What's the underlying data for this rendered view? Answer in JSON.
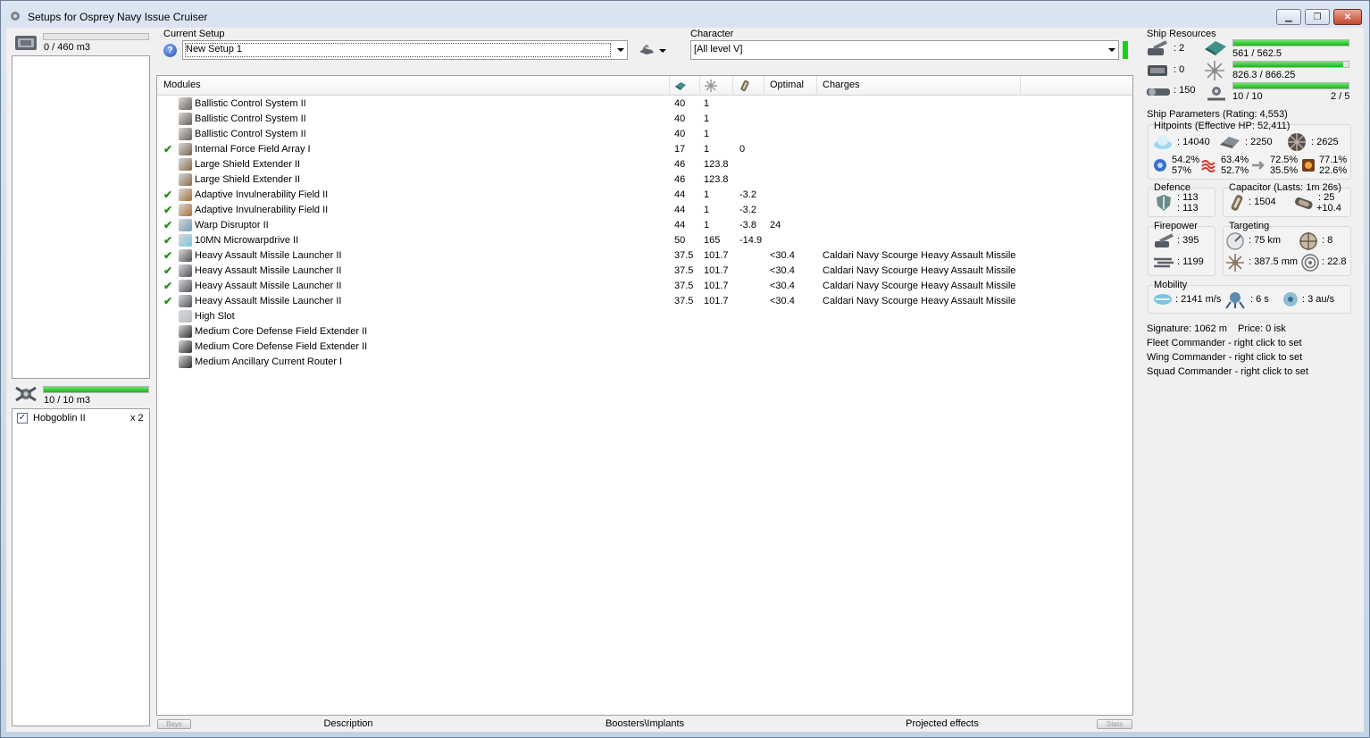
{
  "window": {
    "title": "Setups for Osprey Navy Issue Cruiser",
    "minimize_icon": "minimize-icon",
    "maximize_icon": "maximize-icon",
    "close_icon": "close-icon"
  },
  "left": {
    "cargo_capacity": "0 / 460 m3",
    "cargo_fill": 0.0,
    "drone_capacity": "10 / 10 m3",
    "drone_fill": 1.0,
    "drones": [
      {
        "name": "Hobgoblin II",
        "count": "x 2",
        "checked": true
      }
    ]
  },
  "setup": {
    "current_setup_label": "Current Setup",
    "current_setup_value": "New Setup 1",
    "character_label": "Character",
    "character_value": "[All level V]"
  },
  "modules": {
    "headers": [
      "Modules",
      "Optimal",
      "Charges"
    ],
    "rows": [
      {
        "check": "",
        "name": "Ballistic Control System II",
        "cpu": "40",
        "pg": "1",
        "cap": "",
        "optimal": "",
        "charges": "",
        "icon": "ballistic-control-icon"
      },
      {
        "check": "",
        "name": "Ballistic Control System II",
        "cpu": "40",
        "pg": "1",
        "cap": "",
        "optimal": "",
        "charges": "",
        "icon": "ballistic-control-icon"
      },
      {
        "check": "",
        "name": "Ballistic Control System II",
        "cpu": "40",
        "pg": "1",
        "cap": "",
        "optimal": "",
        "charges": "",
        "icon": "ballistic-control-icon"
      },
      {
        "check": "✔",
        "name": "Internal Force Field Array I",
        "cpu": "17",
        "pg": "1",
        "cap": "0",
        "optimal": "",
        "charges": "",
        "icon": "force-field-icon"
      },
      {
        "check": "",
        "name": "Large Shield Extender II",
        "cpu": "46",
        "pg": "123.8",
        "cap": "",
        "optimal": "",
        "charges": "",
        "icon": "shield-extender-icon"
      },
      {
        "check": "",
        "name": "Large Shield Extender II",
        "cpu": "46",
        "pg": "123.8",
        "cap": "",
        "optimal": "",
        "charges": "",
        "icon": "shield-extender-icon"
      },
      {
        "check": "✔",
        "name": "Adaptive Invulnerability Field II",
        "cpu": "44",
        "pg": "1",
        "cap": "-3.2",
        "optimal": "",
        "charges": "",
        "icon": "invulnerability-field-icon"
      },
      {
        "check": "✔",
        "name": "Adaptive Invulnerability Field II",
        "cpu": "44",
        "pg": "1",
        "cap": "-3.2",
        "optimal": "",
        "charges": "",
        "icon": "invulnerability-field-icon"
      },
      {
        "check": "✔",
        "name": "Warp Disruptor II",
        "cpu": "44",
        "pg": "1",
        "cap": "-3.8",
        "optimal": "24",
        "charges": "",
        "icon": "warp-disruptor-icon"
      },
      {
        "check": "✔",
        "name": "10MN Microwarpdrive II",
        "cpu": "50",
        "pg": "165",
        "cap": "-14.9",
        "optimal": "",
        "charges": "",
        "icon": "microwarpdrive-icon"
      },
      {
        "check": "✔",
        "name": "Heavy Assault Missile Launcher II",
        "cpu": "37.5",
        "pg": "101.7",
        "cap": "",
        "optimal": "<30.4",
        "charges": "Caldari Navy Scourge Heavy Assault Missile",
        "icon": "missile-launcher-icon"
      },
      {
        "check": "✔",
        "name": "Heavy Assault Missile Launcher II",
        "cpu": "37.5",
        "pg": "101.7",
        "cap": "",
        "optimal": "<30.4",
        "charges": "Caldari Navy Scourge Heavy Assault Missile",
        "icon": "missile-launcher-icon"
      },
      {
        "check": "✔",
        "name": "Heavy Assault Missile Launcher II",
        "cpu": "37.5",
        "pg": "101.7",
        "cap": "",
        "optimal": "<30.4",
        "charges": "Caldari Navy Scourge Heavy Assault Missile",
        "icon": "missile-launcher-icon"
      },
      {
        "check": "✔",
        "name": "Heavy Assault Missile Launcher II",
        "cpu": "37.5",
        "pg": "101.7",
        "cap": "",
        "optimal": "<30.4",
        "charges": "Caldari Navy Scourge Heavy Assault Missile",
        "icon": "missile-launcher-icon"
      },
      {
        "check": "",
        "name": "High Slot",
        "cpu": "",
        "pg": "",
        "cap": "",
        "optimal": "",
        "charges": "",
        "icon": "high-slot-icon"
      },
      {
        "check": "",
        "name": "Medium Core Defense Field Extender II",
        "cpu": "",
        "pg": "",
        "cap": "",
        "optimal": "",
        "charges": "",
        "icon": "rig-icon"
      },
      {
        "check": "",
        "name": "Medium Core Defense Field Extender II",
        "cpu": "",
        "pg": "",
        "cap": "",
        "optimal": "",
        "charges": "",
        "icon": "rig-icon"
      },
      {
        "check": "",
        "name": "Medium Ancillary Current Router I",
        "cpu": "",
        "pg": "",
        "cap": "",
        "optimal": "",
        "charges": "",
        "icon": "rig-icon"
      }
    ]
  },
  "resources": {
    "title": "Ship Resources",
    "turret_hardpoints": ": 2",
    "launcher_hardpoints": ": 0",
    "calibration": ": 150",
    "cpu": "561 / 562.5",
    "cpu_fill": 0.997,
    "powergrid": "826.3 / 866.25",
    "powergrid_fill": 0.954,
    "drone_bandwidth": "10 / 10",
    "drone_bandwidth_fill": 1.0,
    "drones_active": "2 / 5"
  },
  "params": {
    "title": "Ship Parameters (Rating: 4,553)",
    "hitpoints_title": "Hitpoints (Effective HP: 52,411)",
    "shield_hp": ": 14040",
    "armor_hp": ": 2250",
    "structure_hp": ": 2625",
    "res_em_shield": "54.2%",
    "res_em_armor": "57%",
    "res_th_shield": "63.4%",
    "res_th_armor": "52.7%",
    "res_kin_shield": "72.5%",
    "res_kin_armor": "35.5%",
    "res_exp_shield": "77.1%",
    "res_exp_armor": "22.6%",
    "defence_title": "Defence",
    "defence_1": ": 113",
    "defence_2": ": 113",
    "capacitor_title": "Capacitor (Lasts: 1m 26s)",
    "capacitor_amount": ": 1504",
    "capacitor_1": ": 25",
    "capacitor_2": "+10.4",
    "firepower_title": "Firepower",
    "firepower_1": ": 395",
    "firepower_2": ": 1199",
    "targeting_title": "Targeting",
    "targeting_range": ": 75 km",
    "targeting_max": ": 8",
    "scan_res": ": 387.5 mm",
    "sensor_strength": ": 22.8",
    "mobility_title": "Mobility",
    "speed": ": 2141 m/s",
    "align": ": 6 s",
    "warp": ": 3 au/s",
    "signature": "Signature: 1062 m",
    "price": "Price: 0 isk",
    "fleet_commander": "Fleet Commander - right click to set",
    "wing_commander": "Wing Commander - right click to set",
    "squad_commander": "Squad Commander - right click to set"
  },
  "bottom": {
    "bays": "Bays",
    "description": "Description",
    "boosters": "Boosters\\Implants",
    "projected": "Projected effects",
    "stats": "Stats"
  },
  "colors": {
    "accent_green": "#16b816",
    "check_green": "#2a8d1f"
  }
}
